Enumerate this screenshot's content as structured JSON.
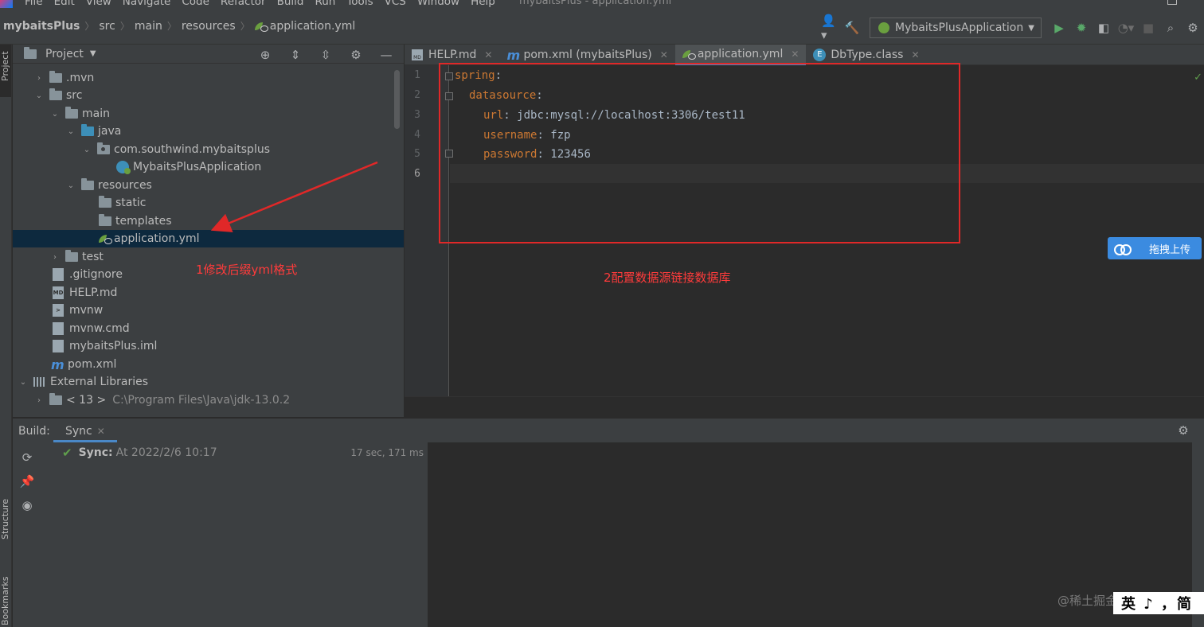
{
  "menubar": {
    "items": [
      "File",
      "Edit",
      "View",
      "Navigate",
      "Code",
      "Refactor",
      "Build",
      "Run",
      "Tools",
      "VCS",
      "Window",
      "Help"
    ],
    "window_title": "mybaitsPlus - application.yml"
  },
  "breadcrumb": [
    "mybaitsPlus",
    "src",
    "main",
    "resources",
    "application.yml"
  ],
  "run_config": {
    "label": "MybaitsPlusApplication"
  },
  "left_stripe": {
    "project": "Project",
    "structure": "Structure",
    "bookmarks": "Bookmarks"
  },
  "project_panel": {
    "title": "Project",
    "tree": [
      {
        "label": ".mvn",
        "arrow": "›"
      },
      {
        "label": "src",
        "arrow": "⌄"
      },
      {
        "label": "main",
        "arrow": "⌄"
      },
      {
        "label": "java",
        "arrow": "⌄"
      },
      {
        "label": "com.southwind.mybaitsplus",
        "arrow": "⌄"
      },
      {
        "label": "MybaitsPlusApplication"
      },
      {
        "label": "resources",
        "arrow": "⌄"
      },
      {
        "label": "static"
      },
      {
        "label": "templates"
      },
      {
        "label": "application.yml",
        "selected": true
      },
      {
        "label": "test",
        "arrow": "›"
      },
      {
        "label": ".gitignore"
      },
      {
        "label": "HELP.md"
      },
      {
        "label": "mvnw"
      },
      {
        "label": "mvnw.cmd"
      },
      {
        "label": "mybaitsPlus.iml"
      },
      {
        "label": "pom.xml"
      },
      {
        "label": "External Libraries",
        "arrow": "⌄"
      },
      {
        "label": "< 13 >",
        "detail": "C:\\Program Files\\Java\\jdk-13.0.2",
        "arrow": "›"
      }
    ]
  },
  "editor_tabs": [
    {
      "label": "HELP.md"
    },
    {
      "label": "pom.xml (mybaitsPlus)"
    },
    {
      "label": "application.yml",
      "active": true
    },
    {
      "label": "DbType.class"
    }
  ],
  "editor": {
    "line_numbers": [
      "1",
      "2",
      "3",
      "4",
      "5",
      "6"
    ],
    "lines": [
      {
        "key": "spring",
        "sep": ":",
        "value": ""
      },
      {
        "key": "datasource",
        "sep": ":",
        "value": ""
      },
      {
        "key": "url",
        "sep": ": ",
        "value": "jdbc:mysql://localhost:3306/test11"
      },
      {
        "key": "username",
        "sep": ": ",
        "value": "fzp"
      },
      {
        "key": "password",
        "sep": ": ",
        "value": "123456"
      }
    ]
  },
  "annotations": {
    "tree_note": "1修改后缀yml格式",
    "editor_note": "2配置数据源链接数据库"
  },
  "upload_widget": {
    "label": "拖拽上传"
  },
  "build_panel": {
    "title": "Build:",
    "tab": "Sync",
    "sync_label": "Sync:",
    "sync_time": "At 2022/2/6 10:17",
    "duration": "17 sec, 171 ms"
  },
  "watermark": "@稀土掘金技术社区",
  "ime_bar": "英 ♪ ，简"
}
